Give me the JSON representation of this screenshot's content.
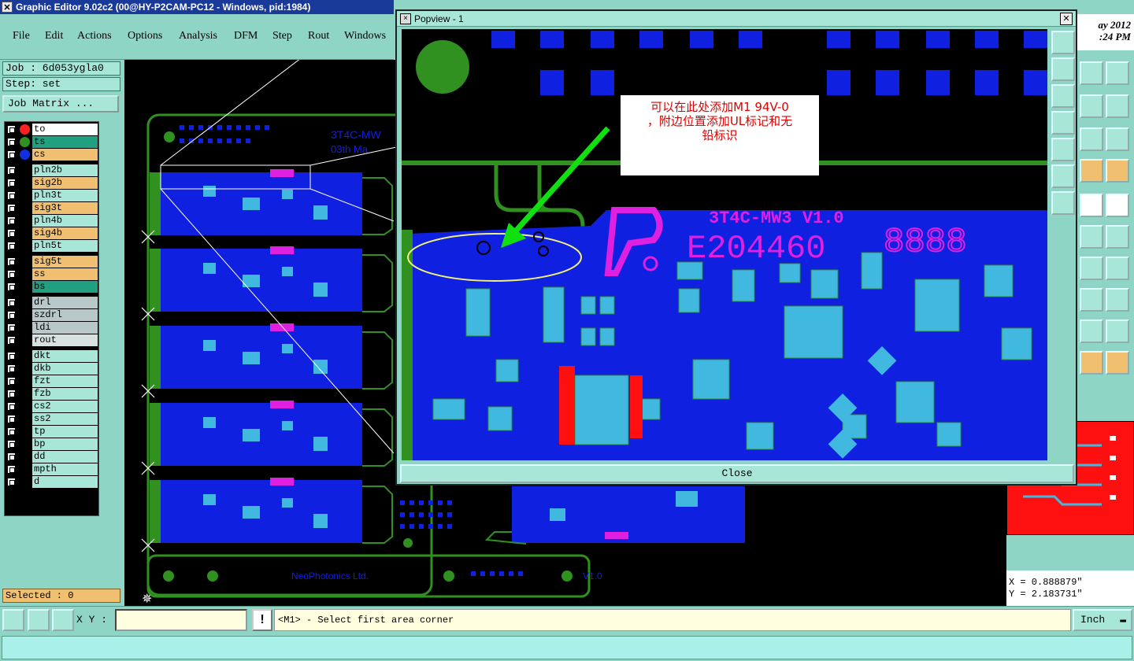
{
  "window": {
    "title": "Graphic Editor 9.02c2 (00@HY-P2CAM-PC12 - Windows, pid:1984)",
    "close_glyph": "✕"
  },
  "menu": [
    "File",
    "Edit",
    "Actions",
    "Options",
    "Analysis",
    "DFM",
    "Step",
    "Rout",
    "Windows"
  ],
  "job": {
    "label": "Job : 6d053ygla0",
    "step": "Step: set",
    "matrix_button": "Job Matrix ..."
  },
  "layers": [
    {
      "name": "to",
      "bg": "#ffffff",
      "dot": "#ff2020"
    },
    {
      "name": "ts",
      "bg": "#20a080",
      "dot": "#309020"
    },
    {
      "name": "cs",
      "bg": "#f0c070",
      "dot": "#1030e0"
    },
    {
      "name": "pln2b",
      "bg": "#a8e6d8",
      "dot": ""
    },
    {
      "name": "sig2b",
      "bg": "#f0c070",
      "dot": ""
    },
    {
      "name": "pln3t",
      "bg": "#a8e6d8",
      "dot": ""
    },
    {
      "name": "sig3t",
      "bg": "#f0c070",
      "dot": ""
    },
    {
      "name": "pln4b",
      "bg": "#a8e6d8",
      "dot": ""
    },
    {
      "name": "sig4b",
      "bg": "#f0c070",
      "dot": ""
    },
    {
      "name": "pln5t",
      "bg": "#a8e6d8",
      "dot": ""
    },
    {
      "name": "sig5t",
      "bg": "#f0c070",
      "dot": ""
    },
    {
      "name": "ss",
      "bg": "#f0c070",
      "dot": ""
    },
    {
      "name": "bs",
      "bg": "#20a080",
      "dot": ""
    },
    {
      "name": "drl",
      "bg": "#b8c8c8",
      "dot": ""
    },
    {
      "name": "szdrl",
      "bg": "#b8c8c8",
      "dot": ""
    },
    {
      "name": "ldi",
      "bg": "#b8c8c8",
      "dot": ""
    },
    {
      "name": "rout",
      "bg": "#d8e0e0",
      "dot": ""
    },
    {
      "name": "dkt",
      "bg": "#a8e6d8",
      "dot": ""
    },
    {
      "name": "dkb",
      "bg": "#a8e6d8",
      "dot": ""
    },
    {
      "name": "fzt",
      "bg": "#a8e6d8",
      "dot": ""
    },
    {
      "name": "fzb",
      "bg": "#a8e6d8",
      "dot": ""
    },
    {
      "name": "cs2",
      "bg": "#a8e6d8",
      "dot": ""
    },
    {
      "name": "ss2",
      "bg": "#a8e6d8",
      "dot": ""
    },
    {
      "name": "tp",
      "bg": "#a8e6d8",
      "dot": ""
    },
    {
      "name": "bp",
      "bg": "#a8e6d8",
      "dot": ""
    },
    {
      "name": "dd",
      "bg": "#a8e6d8",
      "dot": ""
    },
    {
      "name": "mpth",
      "bg": "#a8e6d8",
      "dot": ""
    },
    {
      "name": "d",
      "bg": "#a8e6d8",
      "dot": ""
    }
  ],
  "selected": "Selected : 0",
  "date": {
    "line1": "ay 2012",
    "line2": ":24 PM"
  },
  "coords": {
    "x": "X = 0.888879\"",
    "y": "Y = 2.183731\""
  },
  "canvas_text": {
    "board_title": "3T4C-MW",
    "board_date": "03th Ma",
    "company": "NeoPhotonics Ltd.",
    "version": "V1.0"
  },
  "popview": {
    "title": "Popview - 1",
    "close_button": "Close",
    "board_label": "3T4C-MW3  V1.0",
    "ul_number": "E204460",
    "digit_box": "8888",
    "annotation_line1": "可以在此处添加M1 94V-0",
    "annotation_line2": "，附边位置添加UL标记和无",
    "annotation_line3": "铅标识"
  },
  "bottom": {
    "xy_label": "X Y :",
    "xy_value": "",
    "warn": "!",
    "prompt": "<M1> - Select first area corner",
    "unit": "Inch"
  },
  "colors": {
    "panel": "#8fd5c5",
    "copper": "#1020e0",
    "pad": "#40b8e0",
    "outline": "#309020",
    "silk": "#e020e0",
    "mask": "#ff1010"
  }
}
